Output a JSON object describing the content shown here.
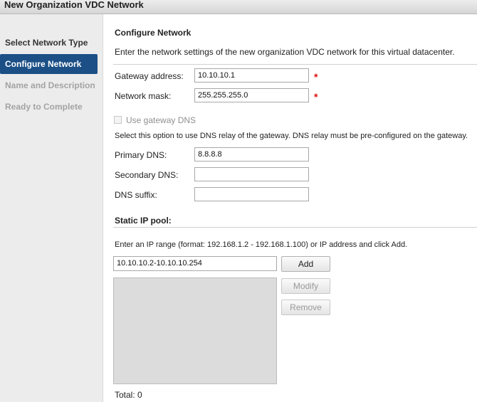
{
  "window": {
    "title": "New Organization VDC Network"
  },
  "steps": [
    {
      "label": "Select Network Type",
      "state": "done"
    },
    {
      "label": "Configure Network",
      "state": "active"
    },
    {
      "label": "Name and Description",
      "state": "disabled"
    },
    {
      "label": "Ready to Complete",
      "state": "disabled"
    }
  ],
  "section": {
    "title": "Configure Network",
    "description": "Enter the network settings of the new organization VDC network for this virtual datacenter."
  },
  "gateway": {
    "label": "Gateway address:",
    "value": "10.10.10.1",
    "required_mark": "*"
  },
  "mask": {
    "label": "Network mask:",
    "value": "255.255.255.0",
    "required_mark": "*"
  },
  "gateway_dns": {
    "label": "Use gateway DNS",
    "checked": false,
    "hint": "Select this option to use DNS relay of the gateway. DNS relay must be pre-configured on the gateway."
  },
  "dns": {
    "primary_label": "Primary DNS:",
    "primary_value": "8.8.8.8",
    "secondary_label": "Secondary DNS:",
    "secondary_value": "",
    "suffix_label": "DNS suffix:",
    "suffix_value": ""
  },
  "pool": {
    "title": "Static IP pool:",
    "instructions": "Enter an IP range (format: 192.168.1.2 - 192.168.1.100) or IP address and click Add.",
    "input_value": "10.10.10.2-10.10.10.254",
    "add_label": "Add",
    "modify_label": "Modify",
    "remove_label": "Remove",
    "total": "Total: 0"
  }
}
